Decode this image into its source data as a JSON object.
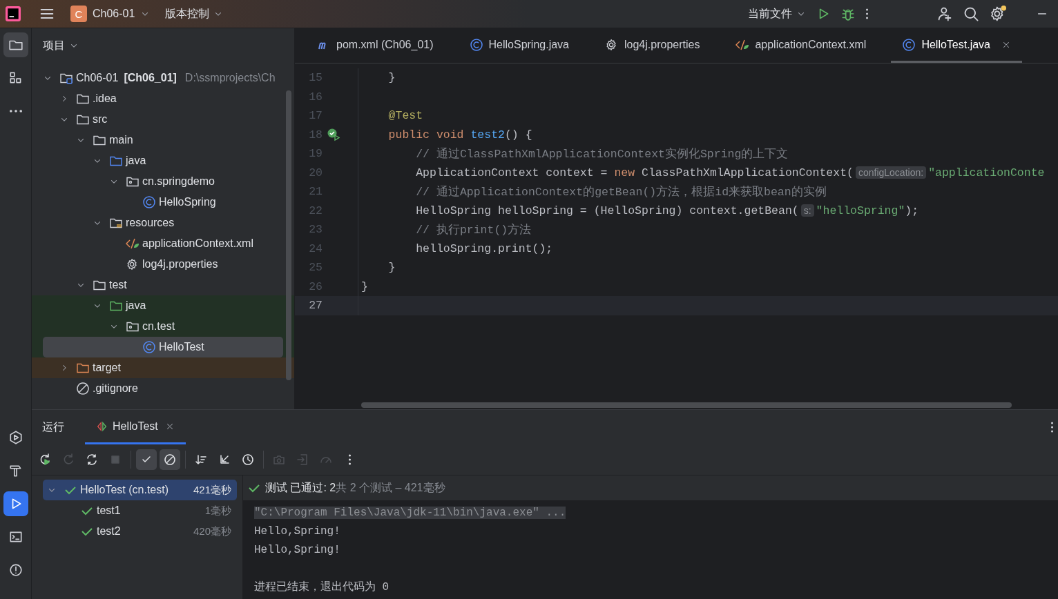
{
  "topbar": {
    "project_badge": "C",
    "project": "Ch06-01",
    "vcs": "版本控制",
    "run_config": "当前文件",
    "settings_notification": true
  },
  "left_strip": {
    "top": [
      {
        "kind": "folder",
        "selected": true
      },
      {
        "kind": "structure",
        "selected": false
      },
      {
        "kind": "more",
        "selected": false
      }
    ],
    "bottom": [
      {
        "kind": "services",
        "selected": false
      },
      {
        "kind": "build",
        "selected": false
      },
      {
        "kind": "run",
        "selected": true
      },
      {
        "kind": "terminal",
        "selected": false
      },
      {
        "kind": "problems",
        "selected": false
      }
    ]
  },
  "project_panel": {
    "title": "项目",
    "tree": [
      {
        "kind": "module",
        "label": "Ch06-01",
        "module": "[Ch06_01]",
        "path": "D:\\ssmprojects\\Ch",
        "expanded": true,
        "selected": false,
        "children": [
          {
            "kind": "folder",
            "label": ".idea",
            "expanded": false,
            "selected": false
          },
          {
            "kind": "folder",
            "label": "src",
            "expanded": true,
            "selected": false,
            "children": [
              {
                "kind": "folder",
                "label": "main",
                "expanded": true,
                "selected": false,
                "children": [
                  {
                    "kind": "source-folder",
                    "label": "java",
                    "expanded": true,
                    "selected": false,
                    "children": [
                      {
                        "kind": "package",
                        "label": "cn.springdemo",
                        "expanded": true,
                        "selected": false,
                        "children": [
                          {
                            "kind": "class",
                            "label": "HelloSpring",
                            "selected": false
                          }
                        ]
                      }
                    ]
                  },
                  {
                    "kind": "resource-folder",
                    "label": "resources",
                    "expanded": true,
                    "selected": false,
                    "children": [
                      {
                        "kind": "xml",
                        "label": "applicationContext.xml",
                        "selected": false
                      },
                      {
                        "kind": "properties",
                        "label": "log4j.properties",
                        "selected": false
                      }
                    ]
                  }
                ]
              },
              {
                "kind": "folder",
                "label": "test",
                "expanded": true,
                "selected": false,
                "children": [
                  {
                    "kind": "test-folder",
                    "label": "java",
                    "expanded": true,
                    "selected": false,
                    "test_source": true,
                    "children": [
                      {
                        "kind": "package",
                        "label": "cn.test",
                        "expanded": true,
                        "selected": false,
                        "test_source": true,
                        "children": [
                          {
                            "kind": "class",
                            "label": "HelloTest",
                            "selected": true,
                            "test_source": true
                          }
                        ]
                      }
                    ]
                  }
                ]
              }
            ]
          },
          {
            "kind": "excluded-folder",
            "label": "target",
            "expanded": false,
            "selected": false,
            "excluded": true
          },
          {
            "kind": "ignore-file",
            "label": ".gitignore",
            "selected": false
          }
        ]
      }
    ]
  },
  "editor": {
    "tabs": [
      {
        "kind": "maven",
        "label": "pom.xml (Ch06_01)",
        "selected": false,
        "closable": false
      },
      {
        "kind": "class",
        "label": "HelloSpring.java",
        "selected": false,
        "closable": false
      },
      {
        "kind": "properties",
        "label": "log4j.properties",
        "selected": false,
        "closable": false
      },
      {
        "kind": "xml",
        "label": "applicationContext.xml",
        "selected": false,
        "closable": false
      },
      {
        "kind": "class",
        "label": "HelloTest.java",
        "selected": true,
        "closable": true
      }
    ],
    "lines": [
      {
        "number": "15",
        "current": false,
        "segments": [
          {
            "kind": "plain",
            "text": "    }"
          }
        ]
      },
      {
        "number": "16",
        "current": false
      },
      {
        "number": "17",
        "current": false,
        "segments": [
          {
            "kind": "annotation",
            "text": "    @Test"
          }
        ]
      },
      {
        "number": "18",
        "current": false,
        "test_passed": true,
        "segments": [
          {
            "kind": "keyword",
            "text": "    public void "
          },
          {
            "kind": "method",
            "text": "test2"
          },
          {
            "kind": "plain",
            "text": "() {"
          }
        ]
      },
      {
        "number": "19",
        "current": false,
        "segments": [
          {
            "kind": "comment",
            "text": "        // 通过ClassPathXmlApplicationContext实例化Spring的上下文"
          }
        ]
      },
      {
        "number": "20",
        "current": false,
        "segments": [
          {
            "kind": "plain",
            "text": "        ApplicationContext context = "
          },
          {
            "kind": "keyword",
            "text": "new "
          },
          {
            "kind": "plain",
            "text": "ClassPathXmlApplicationContext("
          },
          {
            "kind": "hint",
            "text": "configLocation:"
          },
          {
            "kind": "string",
            "text": "\"applicationConte"
          }
        ]
      },
      {
        "number": "21",
        "current": false,
        "segments": [
          {
            "kind": "comment",
            "text": "        // 通过ApplicationContext的getBean()方法，根据id来获取bean的实例"
          }
        ]
      },
      {
        "number": "22",
        "current": false,
        "segments": [
          {
            "kind": "plain",
            "text": "        HelloSpring helloSpring = (HelloSpring) context.getBean("
          },
          {
            "kind": "hint",
            "text": "s:"
          },
          {
            "kind": "string",
            "text": "\"helloSpring\""
          },
          {
            "kind": "plain",
            "text": ");"
          }
        ]
      },
      {
        "number": "23",
        "current": false,
        "segments": [
          {
            "kind": "comment",
            "text": "        // 执行print()方法"
          }
        ]
      },
      {
        "number": "24",
        "current": false,
        "segments": [
          {
            "kind": "plain",
            "text": "        helloSpring.print();"
          }
        ]
      },
      {
        "number": "25",
        "current": false,
        "segments": [
          {
            "kind": "plain",
            "text": "    }"
          }
        ]
      },
      {
        "number": "26",
        "current": false,
        "segments": [
          {
            "kind": "plain",
            "text": "}"
          }
        ]
      },
      {
        "number": "27",
        "current": true
      }
    ]
  },
  "run_panel": {
    "title": "运行",
    "tabs": [
      {
        "label": "HelloTest",
        "selected": true,
        "closable": true
      }
    ],
    "toolbar": [
      {
        "kind": "rerun",
        "disabled": false,
        "on": false
      },
      {
        "kind": "rerun-failed",
        "disabled": true,
        "on": false
      },
      {
        "kind": "auto-rerun",
        "disabled": false,
        "on": false
      },
      {
        "kind": "stop",
        "disabled": true,
        "on": false
      },
      {
        "kind": "separator"
      },
      {
        "kind": "show-passed",
        "disabled": false,
        "on": true
      },
      {
        "kind": "show-ignored",
        "disabled": false,
        "on": true
      },
      {
        "kind": "separator"
      },
      {
        "kind": "sort",
        "disabled": false,
        "on": false
      },
      {
        "kind": "collapse",
        "disabled": false,
        "on": false
      },
      {
        "kind": "history",
        "disabled": false,
        "on": false
      },
      {
        "kind": "separator"
      },
      {
        "kind": "screenshot",
        "disabled": true,
        "on": false
      },
      {
        "kind": "import",
        "disabled": true,
        "on": false
      },
      {
        "kind": "coverage",
        "disabled": true,
        "on": false
      },
      {
        "kind": "more",
        "disabled": false,
        "on": false
      }
    ],
    "tests": [
      {
        "label": "HelloTest (cn.test)",
        "time": "421毫秒",
        "passed": true,
        "expanded": true,
        "selected": true,
        "children": [
          {
            "label": "test1",
            "time": "1毫秒",
            "passed": true,
            "selected": false
          },
          {
            "label": "test2",
            "time": "420毫秒",
            "passed": true,
            "selected": false
          }
        ]
      }
    ],
    "status": {
      "passed": true,
      "label": "测试 已通过: 2",
      "summary": "共 2 个测试 – 421毫秒"
    },
    "console": [
      {
        "kind": "command",
        "text": "\"C:\\Program Files\\Java\\jdk-11\\bin\\java.exe\" ..."
      },
      {
        "kind": "output",
        "text": "Hello,Spring!"
      },
      {
        "kind": "output",
        "text": "Hello,Spring!"
      },
      {
        "kind": "blank"
      },
      {
        "kind": "exit",
        "text": "进程已结束，退出代码为 0"
      }
    ]
  }
}
